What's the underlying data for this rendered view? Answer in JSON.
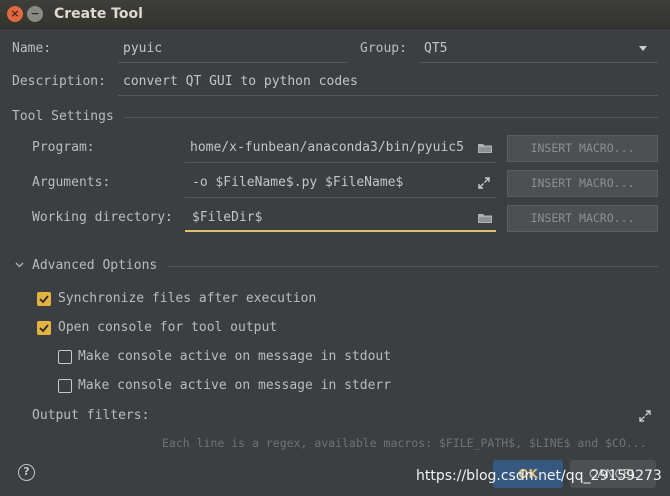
{
  "window": {
    "title": "Create Tool",
    "close_glyph": "×",
    "min_glyph": "−"
  },
  "general": {
    "name_label": "Name:",
    "name_value": "pyuic",
    "group_label": "Group:",
    "group_value": "QT5",
    "description_label": "Description:",
    "description_value": "convert QT GUI to python codes"
  },
  "tool_settings": {
    "header": "Tool Settings",
    "program_label": "Program:",
    "program_value": "home/x-funbean/anaconda3/bin/pyuic5",
    "arguments_label": "Arguments:",
    "arguments_value": "-o $FileName$.py $FileName$",
    "working_dir_label": "Working directory:",
    "working_dir_value": "$FileDir$",
    "insert_macro_label": "INSERT MACRO..."
  },
  "advanced": {
    "header": "Advanced Options",
    "options": [
      {
        "label": "Synchronize files after execution",
        "checked": true
      },
      {
        "label": "Open console for tool output",
        "checked": true
      },
      {
        "label": "Make console active on message in stdout",
        "checked": false
      },
      {
        "label": "Make console active on message in stderr",
        "checked": false
      }
    ],
    "output_filters_label": "Output filters:",
    "output_filters_hint": "Each line is a regex, available macros: $FILE_PATH$, $LINE$ and $CO..."
  },
  "footer": {
    "help_glyph": "?",
    "ok_label": "OK",
    "cancel_label": "CANCEL",
    "watermark": "https://blog.csdn.net/qq_29159273"
  },
  "colors": {
    "accent": "#e0bf6e",
    "checkbox_on": "#e3b341",
    "background": "#3c3f41"
  },
  "icons": [
    "close-icon",
    "minimize-icon",
    "dropdown-arrow-icon",
    "folder-icon",
    "expand-icon",
    "chevron-down-icon",
    "help-icon"
  ]
}
